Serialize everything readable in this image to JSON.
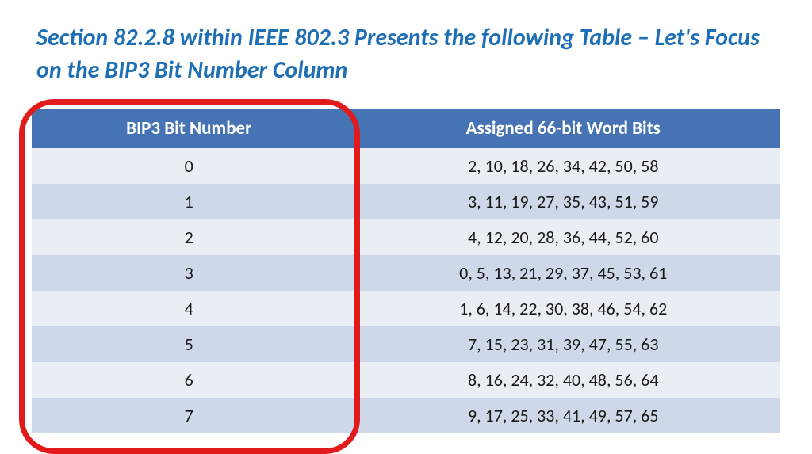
{
  "title": "Section 82.2.8 within IEEE 802.3 Presents the following Table – Let's Focus on the BIP3 Bit Number Column",
  "columns": {
    "col1": "BIP3 Bit Number",
    "col2": "Assigned 66-bit Word Bits"
  },
  "rows": [
    {
      "bip3": "0",
      "bits": "2, 10, 18, 26, 34, 42, 50, 58"
    },
    {
      "bip3": "1",
      "bits": "3, 11, 19, 27, 35, 43, 51, 59"
    },
    {
      "bip3": "2",
      "bits": "4, 12, 20, 28, 36, 44, 52, 60"
    },
    {
      "bip3": "3",
      "bits": "0, 5, 13, 21, 29, 37, 45, 53, 61"
    },
    {
      "bip3": "4",
      "bits": "1, 6, 14, 22, 30, 38, 46, 54, 62"
    },
    {
      "bip3": "5",
      "bits": "7, 15, 23, 31, 39, 47, 55, 63"
    },
    {
      "bip3": "6",
      "bits": "8, 16, 24, 32, 40, 48, 56, 64"
    },
    {
      "bip3": "7",
      "bits": "9, 17, 25, 33, 41, 49, 57, 65"
    }
  ]
}
